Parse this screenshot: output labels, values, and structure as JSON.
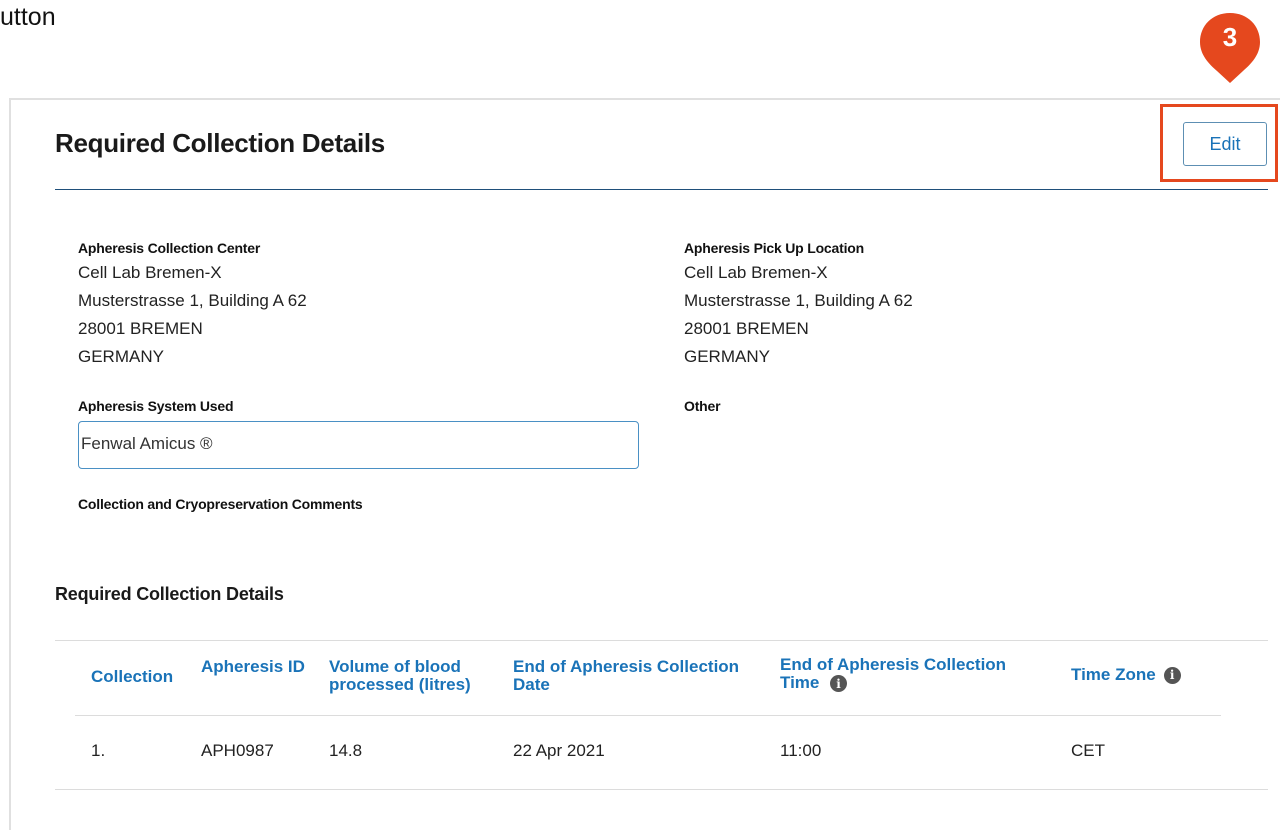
{
  "caption_fragment": "utton",
  "step_marker": {
    "number": "3",
    "color": "#e5481e"
  },
  "card": {
    "title": "Required Collection Details",
    "edit_label": "Edit"
  },
  "collection_center": {
    "label": "Apheresis Collection Center",
    "lines": [
      "Cell Lab Bremen-X",
      "Musterstrasse 1, Building A 62",
      "28001 BREMEN",
      "GERMANY"
    ]
  },
  "pickup_location": {
    "label": "Apheresis Pick Up Location",
    "lines": [
      "Cell Lab Bremen-X",
      "Musterstrasse 1, Building A 62",
      "28001 BREMEN",
      "GERMANY"
    ]
  },
  "system_used": {
    "label": "Apheresis System Used",
    "value": "Fenwal Amicus ®"
  },
  "other": {
    "label": "Other"
  },
  "comments": {
    "label": "Collection and Cryopreservation Comments"
  },
  "details_table": {
    "heading": "Required Collection Details",
    "columns": [
      "Collection",
      "Apheresis ID",
      "Volume of blood processed (litres)",
      "End of Apheresis Collection Date",
      "End of Apheresis Collection Time",
      "Time Zone"
    ],
    "rows": [
      [
        "1.",
        "APH0987",
        "14.8",
        "22 Apr 2021",
        "11:00",
        "CET"
      ]
    ]
  },
  "colors": {
    "accent_blue": "#1a73b8",
    "highlight_red": "#e5481e",
    "rule_navy": "#1f4f7a"
  }
}
